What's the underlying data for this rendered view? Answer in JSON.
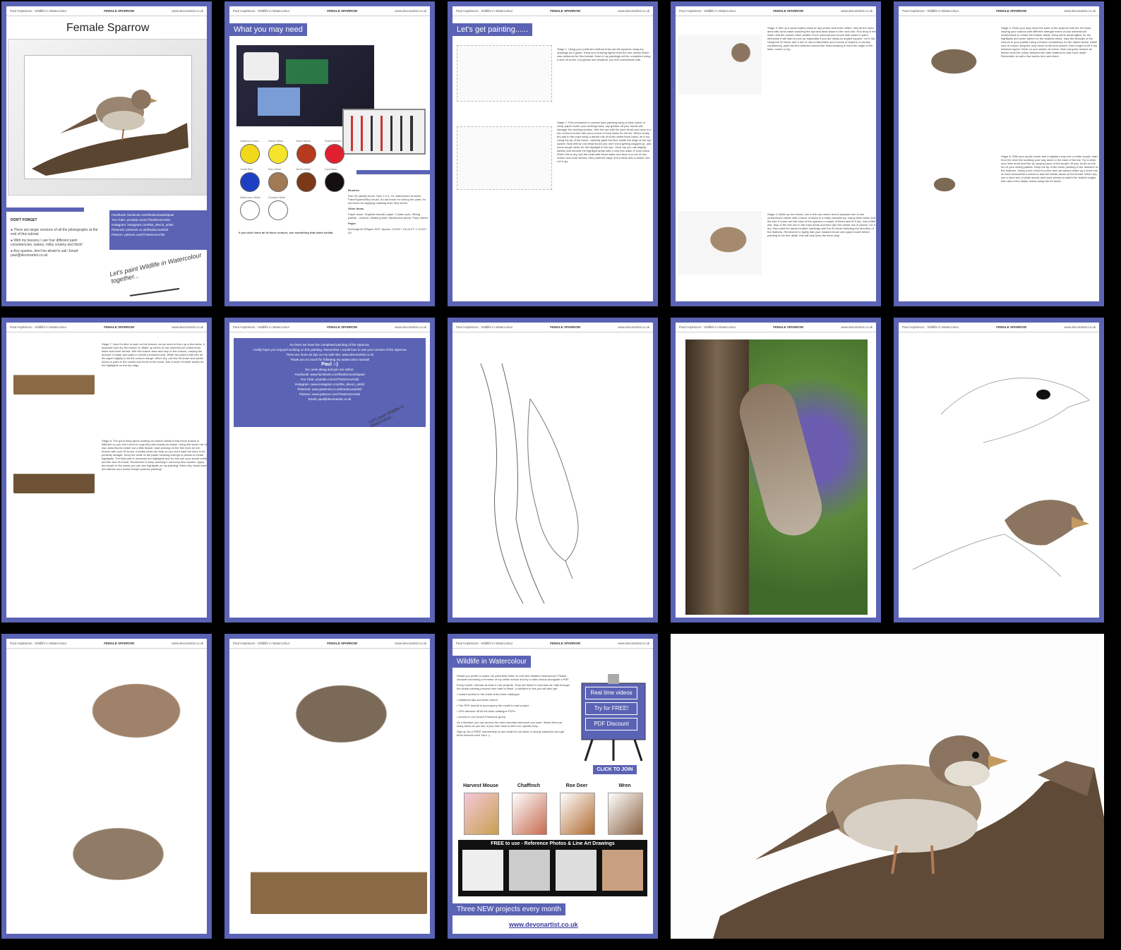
{
  "header": {
    "left": "Paul Hopkinson - Wildlife in Watercolour",
    "center": "FEMALE SPARROW",
    "right": "www.devonartist.co.uk"
  },
  "page1": {
    "title": "Female Sparrow",
    "dont_forget": "DON'T FORGET",
    "bullets": [
      "There are larger versions of all the photographs at the end of this tutorial",
      "With my lessons I use four different paint consistencies, watery, milky creamy and thick!",
      "Any queries, don't be afraid to ask: Email: paul@devonartist.co.uk"
    ],
    "social": [
      "Facebook: facebook.com/thedevonartistpaul",
      "You Tube: youtube.com/c/TheDevonArtist",
      "Instagram: instagram.com/the_devon_artist/",
      "Pinterest: pinterest.co.uk/thedevonartist/",
      "Patreon: patreon.com/TheDevonArtist"
    ],
    "tagline": "Let's paint Wildlife in Watercolour together..."
  },
  "page2": {
    "heading": "What you may need",
    "paints": [
      {
        "name": "Cadmium Lemon",
        "color": "#f2d81a"
      },
      {
        "name": "Hansa Yellow",
        "color": "#f5e52a"
      },
      {
        "name": "Burnt Sienna",
        "color": "#b53a1e"
      },
      {
        "name": "Scarlet Pyrrole",
        "color": "#e02030"
      },
      {
        "name": "Cobalt Blue",
        "color": "#1d3fc4"
      },
      {
        "name": "Raw Umber",
        "color": "#a07a55"
      },
      {
        "name": "Burnt Umber",
        "color": "#7a3a18"
      },
      {
        "name": "Ivory Black",
        "color": "#151010"
      },
      {
        "name": "Watercolour White",
        "color": "#ffffff"
      },
      {
        "name": "Gouache White",
        "color": "#ffffff"
      }
    ],
    "note": "If you don't have all of these colours, use something that looks similar",
    "brushes_title": "Brushes",
    "brushes": "Size 00 (detail) brush. Size 1 & 9, 15, watercolour brushes. Fake/Squirrel/Mop brush. An old brush for mixing the paint. An old brush for applying masking fluid. Mop brush.",
    "other_title": "Other Items",
    "other": "Paper towel. Graphite transfer paper. 2 water pots. Mixing palette - ceramic. Masking fluid. Mechanical pencil. Putty rubber.",
    "paper_title": "Paper",
    "paper": "Bockingford 300gsm NOT. Approx: 21x29.7 cm (8.27\" x 11.69\") A4"
  },
  "page3": {
    "heading": "Let's get painting......",
    "stage1": "Stage 1. Using your preferred method draw out the sparrow using my drawings as a guide. Keep your drawing lighter than the one shown which was darkened for this tutorial. Most of my paintings will be completed using a size 00 brush, but please use whatever you feel comfortable with.",
    "stage2": "Stage 2. First remember to protect your painting using a clean piece of scrap paper under your working hand, any grease off your hands will damage the working surface. Wet the eye with the pure brush and drop in a mix of burnt umber with just a touch of ivory black for the iris. When nearly dry add in the pupil using a darker mix of burnt umber/ivory black, let it dry. Using the tip of the brush, carefully paint the blue inside the edge of the eye socket. Now with an old detail brush you don't mind getting clogged up, add some acrylic white for the highlight in the eye. Once dry you can slightly darken and smooth the highlight areas with a very thin wash of ivory black. When this is dry, wet the beak with clean water and drop in a mix of raw umber and burnt sienna, then paint the edge of the beak with a darker mix. Let it dry."
  },
  "page4": {
    "stage3": "Stage 3. Mix up a weak watery wash of raw umber and burnt umber. Wet all the head area with clean water avoiding the eye and beak down to the neck line. Run drop in the wash until the colours have settled. Don't overload your brush with water or paint, otherwise it will start to pool up especially if you are using an angled support. Let it dry. Using the 00 brush and a mix of raw umber/black and a touch of sepia to a creamy consistency, paint the fine feathers around the head keeping in mind the angle of the lines. Leave to dry.",
    "stage4": "Stage 4. Make up two mixes, one a thin raw umber and a separate mix of raw umber/burnt umber with a touch of sepia to a milky consistency. Using clean water and the size 0 brush wet the back of the sparrow a couple of times and let it dry. Just a little wet, drop in the thin mix in the main areas and then add the darker mix in places. Let it dry, then paint the darker feather markings with the 00 brush following the direction of the feathers. Remember to lightly dab your masked brush onto paper towel before painting in the fine detail, this will help keep the lines crisp."
  },
  "page5": {
    "stage5": "Stage 5. Work your way down the back of the sparrow with the 00 brush, varying your colours with different strength mixes of raw umber/burnt umber/black to create the feather detail. Keep some areas lighter for the highlights and some darker for the shadow areas. Vary the strength of the colours in your palette using a thicker consistency for the darker areas. Make sure of colour using the mop brush to blend in places. Don't forget to let it dry between layers. Work on one section at a time. Now using the mixture as before work the colour between the dark feathers to add more depth. Remember to add a few marks here and there.",
    "stage6": "Stage 6. With your acrylic brush and a slightly runny mix of white acrylic, start from the neck line working your way down to the base of the tail. Try to keep your lines short and fine by varying some of the acrylic off your brush on the rim of your mixing palette. Keep the tip of the brush pointing in the direction of the feathers. Using a mix of burnt umber and raw sienna make up a short mix of burnt sienna/burnt umber to add the darker areas on the breast. When dry, use a short mix of white acrylic and burnt sienna to soften the feather edges, then add a few darker marks using the 00 brush."
  },
  "page6": {
    "stage7": "Stage 7. Now it's time to work on the branch, as we need to liven up a few shots, it depends how dry the branch is. Make up mixes of raw umber/burnt umber/ivory black and burnt sienna. Wet the branch area and drop in the colours, varying the amount of water and paint to create a textured look. While the paint is still wet, tilt the paper slightly to let the colours merge. When dry, use the 00 brush and darker mixes to paint in the cracks and knots in the wood. Add a touch of white acrylic for the highlights on the top edge.",
    "stage8": "Stage 8. The good thing about working on branch detail is that every branch is different so you don't need to copy this part exactly as drawn. Using the same mix of raw umber/burnt umber but a little thicker, start working on the fine lines for the branch with your 00 brush. A shaky hand can help so you don't want the lines to be perfectly straight. Keep the white of the paper showing through in places to create highlights. The final part is obviously the highlights and for this use your acrylic white and the size 00 brush. Remember to keep washing it out every few minutes. Apply the acrylic to the areas you can see highlights on my painting. When dry, stand back and admire your lovely female sparrow painting!"
  },
  "page7": {
    "lines": [
      "So there we have the completed painting of the Sparrow.",
      "I really hope you enjoyed working on this painting. Remember I would love to see your version of the Sparrow.",
      "There are more art tips on my web site: www.devonartist.co.uk",
      "Thank you so much for following my watercolour tutorial!",
      "Paul :-)",
      "Do come along and join me online:",
      "Facebook: www.facebook.com/thedevonartistpaul",
      "You Tube: youtube.com/c/TheDevonArtist",
      "Instagram: www.instagram.com/the_devon_artist/",
      "Pinterest: www.pinterest.co.uk/thedevonartist/",
      "Patreon: www.patreon.com/TheDevonArtist",
      "Email: paul@devonartist.co.uk"
    ],
    "tagline": "Let's paint Wildlife in Watercolour..."
  },
  "page14": {
    "heading": "Wildlife in Watercolour",
    "intro": "Would you prefer to watch me paint AND listen to real time detailed instructions? Please consider becoming a member of my online school and try a video lesson alongside a PDF.",
    "month": "Every month I release at least 3 new projects. They are filmed in real time as I talk through the whole painting process from start to finish. In addition to this you will also get:",
    "benefits": [
      "Instant access to the entire video back catalogue",
      "additional tips and tricks videos",
      "The PDF tutorial to accompany the month's main project",
      "25% discount off all the back catalogue PDFs",
      "access to our closed Facebook group"
    ],
    "member": "As a Member you can access the video tutorials whenever you want. Watch them as many times as you like or just refer back to them for specific help.",
    "signup": "Sign up for a FREE membership to see what it is all about or simply subscribe and get three lessons now! Paul :-)",
    "buttons": [
      "Real time videos",
      "Try for FREE!",
      "PDF Discount"
    ],
    "join": "CLICK TO JOIN",
    "projects": [
      "Harvest Mouse",
      "Chaffinch",
      "Roe Deer",
      "Wren"
    ],
    "free_banner": "FREE to use - Reference Photos & Line Art Drawings",
    "three_new": "Three NEW projects every month",
    "site": "www.devonartist.co.uk"
  },
  "colors": {
    "frame": "#5b63b5",
    "background": "#000000",
    "accent": "#5b63b5"
  },
  "icons": [
    "brush-icon",
    "easel-icon"
  ]
}
